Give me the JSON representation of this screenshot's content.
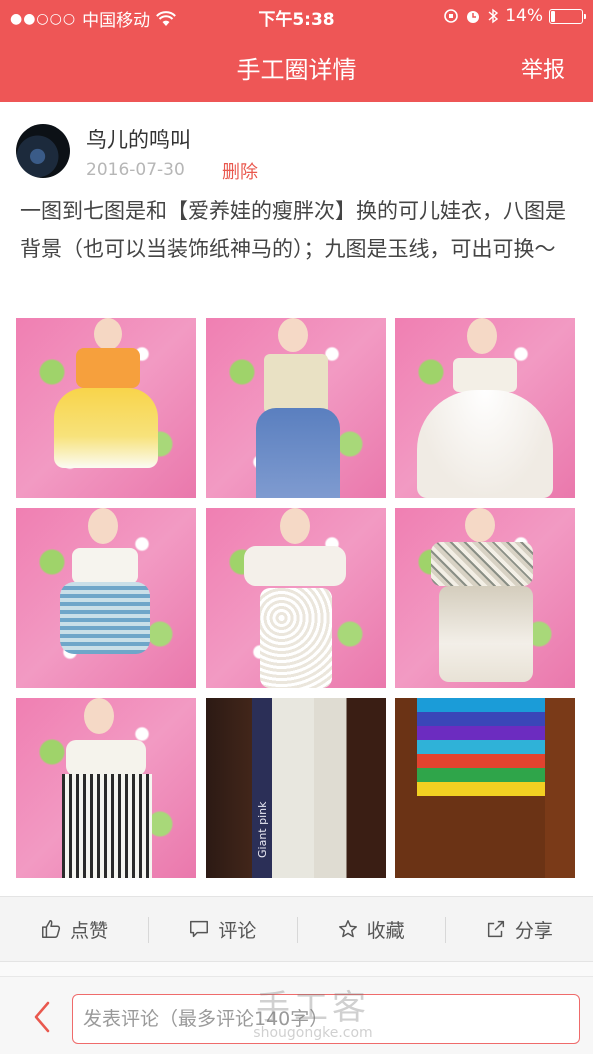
{
  "status_bar": {
    "carrier": "中国移动",
    "time": "下午5:38",
    "battery": "14%",
    "battery_level": 0.14
  },
  "nav": {
    "title": "手工圈详情",
    "report_label": "举报"
  },
  "post": {
    "username": "鸟儿的鸣叫",
    "date": "2016-07-30",
    "delete_label": "删除",
    "content": "一图到七图是和【爱养娃的瘦胖次】换的可儿娃衣，八图是背景（也可以当装饰纸神马的）；九图是玉线，可出可换～"
  },
  "photos": [
    {
      "subject": "doll-orange-yellow-dress"
    },
    {
      "subject": "doll-blue-dress"
    },
    {
      "subject": "doll-white-tulle-dress"
    },
    {
      "subject": "doll-blue-striped-dress"
    },
    {
      "subject": "doll-white-lace-dress"
    },
    {
      "subject": "doll-floral-lace-dress"
    },
    {
      "subject": "doll-black-white-striped-dress"
    },
    {
      "subject": "background-paper-rolls",
      "text": "Giant pink"
    },
    {
      "subject": "jade-thread-bundles"
    }
  ],
  "actions": {
    "like": "点赞",
    "comment": "评论",
    "favorite": "收藏",
    "share": "分享"
  },
  "comment_bar": {
    "placeholder": "发表评论（最多评论140字）"
  },
  "watermark": {
    "text": "手工客",
    "url": "shougongke.com"
  },
  "colors": {
    "brand_red": "#ee5656",
    "delete_red": "#e9584e"
  }
}
